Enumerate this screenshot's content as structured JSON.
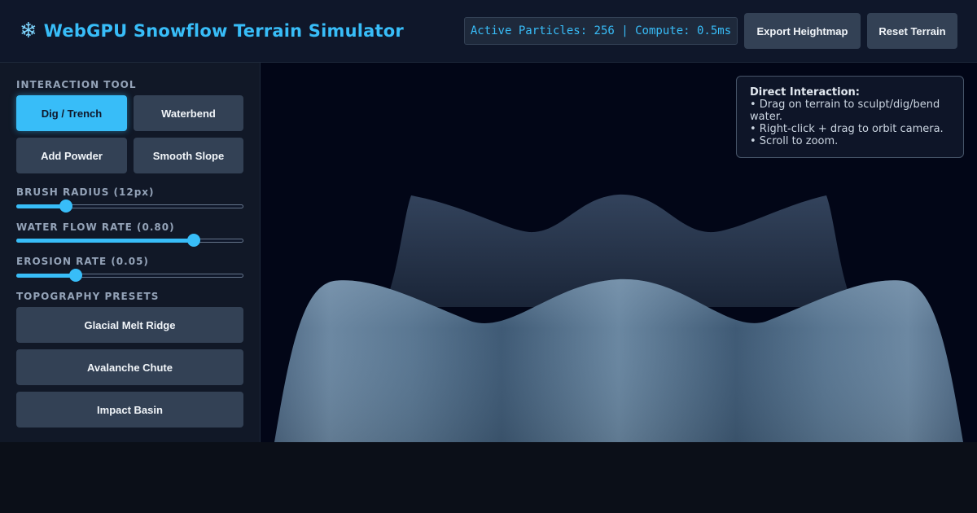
{
  "header": {
    "logo_icon": "snowflake-icon",
    "logo_glyph": "❄",
    "title": "WebGPU Snowflow Terrain Simulator",
    "status": "Active Particles: 256 | Compute: 0.5ms",
    "export_label": "Export Heightmap",
    "reset_label": "Reset Terrain"
  },
  "sidebar": {
    "tool_label": "INTERACTION TOOL",
    "tools": [
      {
        "label": "Dig / Trench",
        "active": true
      },
      {
        "label": "Waterbend",
        "active": false
      },
      {
        "label": "Add Powder",
        "active": false
      },
      {
        "label": "Smooth Slope",
        "active": false
      }
    ],
    "sliders": [
      {
        "label": "BRUSH RADIUS (12px)",
        "value": 0.22
      },
      {
        "label": "WATER FLOW RATE (0.80)",
        "value": 0.78
      },
      {
        "label": "EROSION RATE (0.05)",
        "value": 0.26
      }
    ],
    "presets_label": "TOPOGRAPHY PRESETS",
    "presets": [
      "Glacial Melt Ridge",
      "Avalanche Chute",
      "Impact Basin"
    ]
  },
  "viewport": {
    "hint_title": "Direct Interaction:",
    "hint_lines": [
      "• Drag on terrain to sculpt/dig/bend",
      "water.",
      "• Right-click + drag to orbit camera.",
      "• Scroll to zoom."
    ]
  },
  "colors": {
    "accent": "#38bdf8",
    "panel": "#111827",
    "button": "#334155",
    "viewport_bg": "#020617"
  }
}
